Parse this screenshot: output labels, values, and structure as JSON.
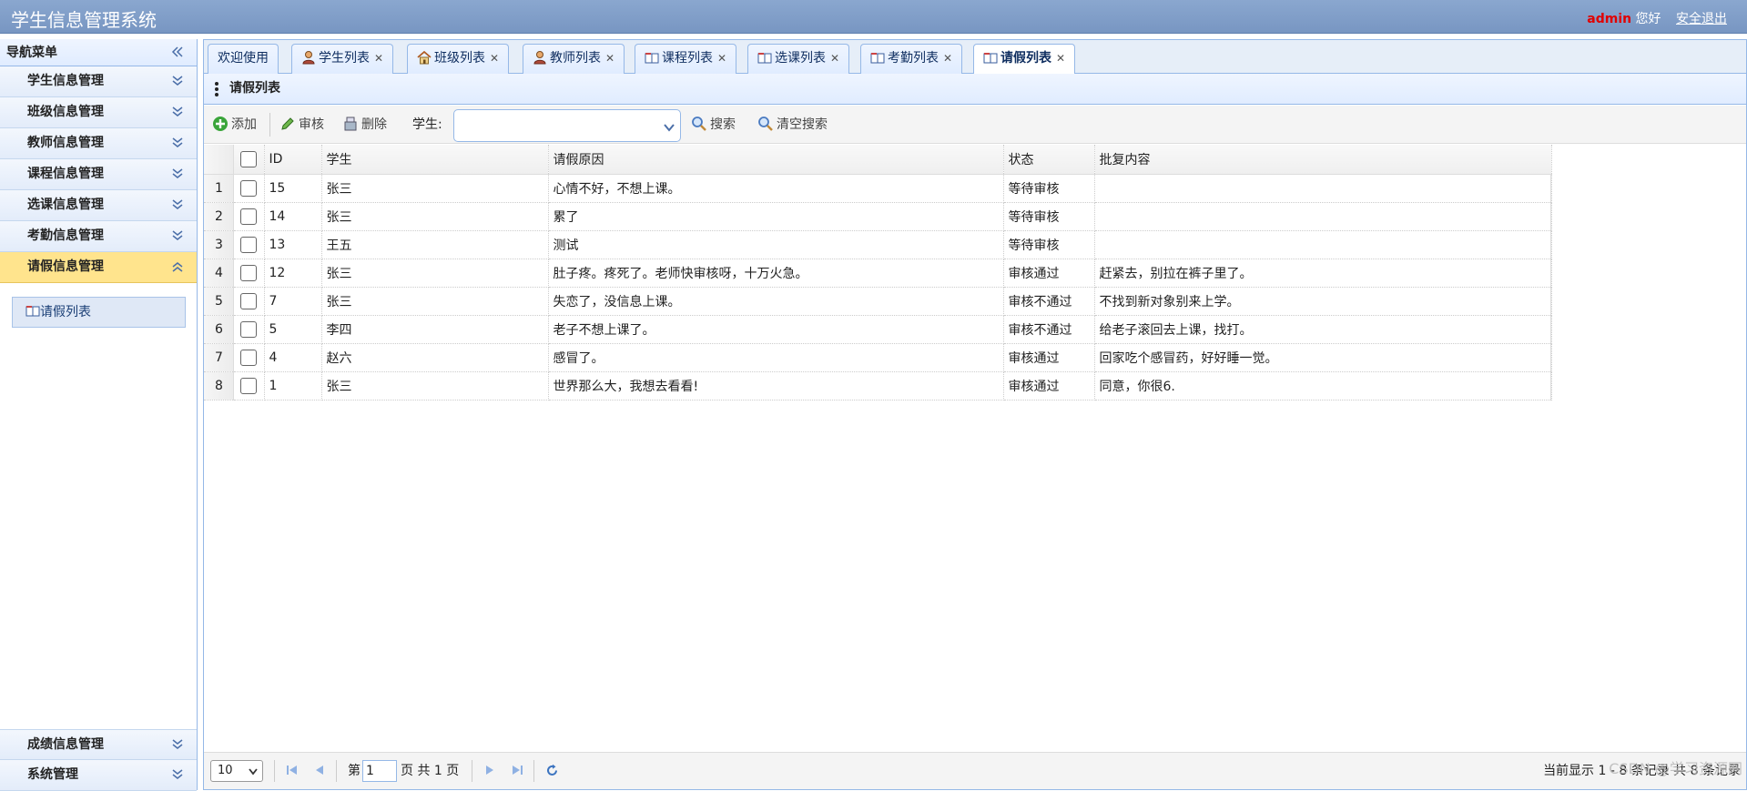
{
  "app": {
    "title": "学生信息管理系统",
    "user": "admin",
    "greeting": "您好",
    "logout": "安全退出"
  },
  "nav": {
    "title": "导航菜单",
    "items": [
      {
        "label": "学生信息管理"
      },
      {
        "label": "班级信息管理"
      },
      {
        "label": "教师信息管理"
      },
      {
        "label": "课程信息管理"
      },
      {
        "label": "选课信息管理"
      },
      {
        "label": "考勤信息管理"
      },
      {
        "label": "请假信息管理"
      }
    ],
    "sub_item": "请假列表",
    "bottom_items": [
      {
        "label": "成绩信息管理"
      },
      {
        "label": "系统管理"
      }
    ]
  },
  "tabs": [
    {
      "label": "欢迎使用",
      "icon": "none"
    },
    {
      "label": "学生列表",
      "icon": "user-icon"
    },
    {
      "label": "班级列表",
      "icon": "house-icon"
    },
    {
      "label": "教师列表",
      "icon": "user-icon"
    },
    {
      "label": "课程列表",
      "icon": "book-icon"
    },
    {
      "label": "选课列表",
      "icon": "book-icon"
    },
    {
      "label": "考勤列表",
      "icon": "book-icon"
    },
    {
      "label": "请假列表",
      "icon": "book-icon"
    }
  ],
  "panel": {
    "title": "请假列表"
  },
  "toolbar": {
    "add": "添加",
    "audit": "审核",
    "delete": "删除",
    "student_label": "学生:",
    "search": "搜索",
    "clear": "清空搜索"
  },
  "grid": {
    "columns": [
      "ID",
      "学生",
      "请假原因",
      "状态",
      "批复内容"
    ],
    "rows": [
      {
        "n": "1",
        "id": "15",
        "student": "张三",
        "reason": "心情不好，不想上课。",
        "status": "等待审核",
        "reply": ""
      },
      {
        "n": "2",
        "id": "14",
        "student": "张三",
        "reason": "累了",
        "status": "等待审核",
        "reply": ""
      },
      {
        "n": "3",
        "id": "13",
        "student": "王五",
        "reason": "测试",
        "status": "等待审核",
        "reply": ""
      },
      {
        "n": "4",
        "id": "12",
        "student": "张三",
        "reason": "肚子疼。疼死了。老师快审核呀，十万火急。",
        "status": "审核通过",
        "reply": "赶紧去，别拉在裤子里了。"
      },
      {
        "n": "5",
        "id": "7",
        "student": "张三",
        "reason": "失恋了，没信息上课。",
        "status": "审核不通过",
        "reply": "不找到新对象别来上学。"
      },
      {
        "n": "6",
        "id": "5",
        "student": "李四",
        "reason": "老子不想上课了。",
        "status": "审核不通过",
        "reply": "给老子滚回去上课，找打。"
      },
      {
        "n": "7",
        "id": "4",
        "student": "赵六",
        "reason": "感冒了。",
        "status": "审核通过",
        "reply": "回家吃个感冒药，好好睡一觉。"
      },
      {
        "n": "8",
        "id": "1",
        "student": "张三",
        "reason": "世界那么大，我想去看看!",
        "status": "审核通过",
        "reply": "同意，你很6."
      }
    ]
  },
  "pager": {
    "page_size": "10",
    "page_prefix": "第",
    "page": "1",
    "page_suffix": "页 共 1 页",
    "info": "当前显示 1 - 8 条记录 共 8 条记录",
    "watermark": "CSDN @学习资源网"
  }
}
